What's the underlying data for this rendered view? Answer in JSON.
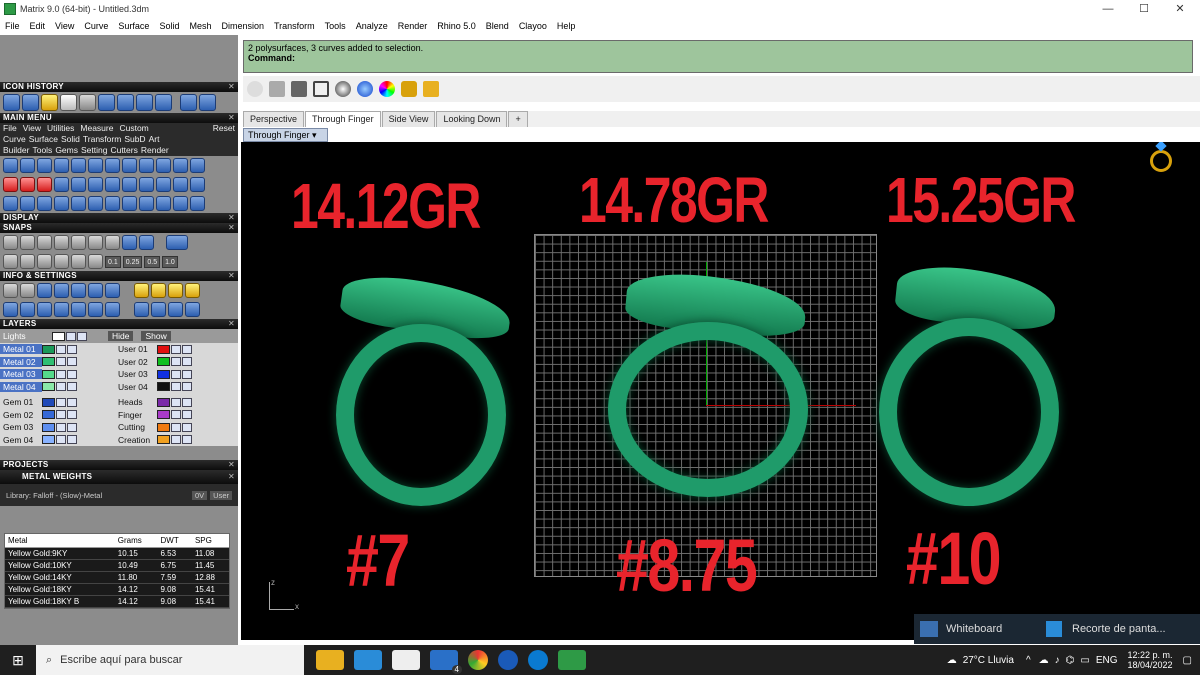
{
  "window": {
    "title": "Matrix 9.0 (64-bit) - Untitled.3dm",
    "controls": [
      "—",
      "☐",
      "✕"
    ]
  },
  "menu": [
    "File",
    "Edit",
    "View",
    "Curve",
    "Surface",
    "Solid",
    "Mesh",
    "Dimension",
    "Transform",
    "Tools",
    "Analyze",
    "Render",
    "Rhino 5.0",
    "Blend",
    "Clayoo",
    "Help"
  ],
  "panels": {
    "icon_history": "ICON HISTORY",
    "main_menu": "MAIN MENU",
    "main_menu_items": [
      "File",
      "View",
      "Utilities",
      "Measure",
      "Custom",
      "Reset"
    ],
    "main_menu_cats1": [
      "Curve",
      "Surface",
      "Solid",
      "Transform",
      "SubD",
      "Art"
    ],
    "main_menu_cats2": [
      "Builder",
      "Tools",
      "Gems",
      "Setting",
      "Cutters",
      "Render"
    ],
    "display": "DISPLAY",
    "snaps": "SNAPS",
    "snap_values": [
      "0.1",
      "0.25",
      "0.5",
      "1.0"
    ],
    "info_settings": "INFO & SETTINGS",
    "layers": "LAYERS",
    "layers_top": {
      "lights": "Lights",
      "hide": "Hide",
      "show": "Show"
    },
    "projects": "PROJECTS",
    "metal_weights": "METAL WEIGHTS"
  },
  "layers_left": [
    {
      "name": "Metal 01",
      "color": "#1a9a5a",
      "sel": true
    },
    {
      "name": "Metal 02",
      "color": "#2fbf73",
      "sel": true
    },
    {
      "name": "Metal 03",
      "color": "#55d98b",
      "sel": true
    },
    {
      "name": "Metal 04",
      "color": "#8ae8a8",
      "sel": true
    },
    {
      "name": "Gem 01",
      "color": "#1f49b8",
      "sel": false
    },
    {
      "name": "Gem 02",
      "color": "#3568d6",
      "sel": false
    },
    {
      "name": "Gem 03",
      "color": "#5d8ef0",
      "sel": false
    },
    {
      "name": "Gem 04",
      "color": "#88b2ff",
      "sel": false
    }
  ],
  "layers_right": [
    {
      "name": "User 01",
      "color": "#e01010"
    },
    {
      "name": "User 02",
      "color": "#10c020"
    },
    {
      "name": "User 03",
      "color": "#1030e0"
    },
    {
      "name": "User 04",
      "color": "#101010"
    },
    {
      "name": "Heads",
      "color": "#7a2aa8"
    },
    {
      "name": "Finger",
      "color": "#a83ac8"
    },
    {
      "name": "Cutting",
      "color": "#f07a10"
    },
    {
      "name": "Creation",
      "color": "#f0a020"
    }
  ],
  "weights": {
    "library": "Library: Falloff - (Slow)-Metal",
    "library_btns": [
      "0V",
      "User"
    ],
    "columns": [
      "Metal",
      "Grams",
      "DWT",
      "SPG"
    ],
    "rows": [
      [
        "Yellow Gold:9KY",
        "10.15",
        "6.53",
        "11.08"
      ],
      [
        "Yellow Gold:10KY",
        "10.49",
        "6.75",
        "11.45"
      ],
      [
        "Yellow Gold:14KY",
        "11.80",
        "7.59",
        "12.88"
      ],
      [
        "Yellow Gold:18KY",
        "14.12",
        "9.08",
        "15.41"
      ],
      [
        "Yellow Gold:18KY B",
        "14.12",
        "9.08",
        "15.41"
      ]
    ]
  },
  "command": {
    "line1": "2 polysurfaces, 3 curves added to selection.",
    "line2": "Command:"
  },
  "viewport_tabs": [
    "Perspective",
    "Through Finger",
    "Side View",
    "Looking Down"
  ],
  "active_viewport": "Through Finger",
  "overlay": {
    "weights": [
      "14.12GR",
      "14.78GR",
      "15.25GR"
    ],
    "sizes": [
      "#7",
      "#8.75",
      "#10"
    ]
  },
  "axes": {
    "z": "z",
    "x": "x"
  },
  "notifications": [
    "Whiteboard",
    "Recorte de panta..."
  ],
  "taskbar": {
    "search_placeholder": "Escribe aquí para buscar",
    "mail_badge": "4",
    "weather": "27°C  Lluvia",
    "lang": "ENG",
    "time": "12:22 p. m.",
    "date": "18/04/2022"
  },
  "colors": {
    "accent_red": "#e8242c",
    "ring_green": "#1f9b6a",
    "cmd_bg": "#9ec59c"
  }
}
